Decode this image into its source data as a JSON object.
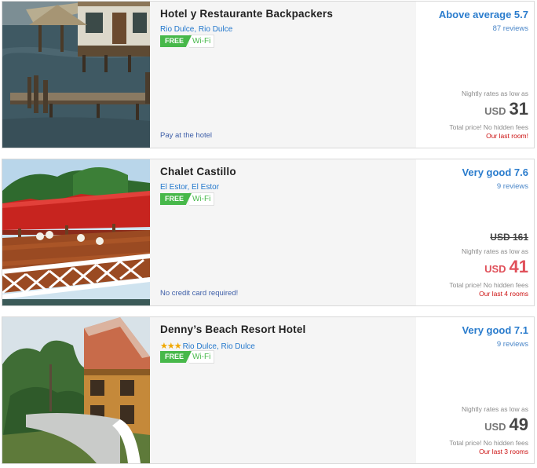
{
  "hotels": [
    {
      "name": "Hotel y Restaurante Backpackers",
      "stars": "",
      "location": "Rio Dulce, Rio Dulce",
      "free_badge": "FREE",
      "amenity": "Wi-Fi",
      "footnote": "Pay at the hotel",
      "rating": "Above average 5.7",
      "reviews": "87 reviews",
      "old_price": "",
      "rates_note": "Nightly rates as low as",
      "currency": "USD",
      "price": "31",
      "total_note": "Total price! No hidden fees",
      "availability": "Our last room!",
      "photo": "stilt-house-dock"
    },
    {
      "name": "Chalet Castillo",
      "stars": "",
      "location": "El Estor, El Estor",
      "free_badge": "FREE",
      "amenity": "Wi-Fi",
      "footnote": "No credit card required!",
      "rating": "Very good 7.6",
      "reviews": "9 reviews",
      "old_price": "USD 161",
      "rates_note": "Nightly rates as low as",
      "currency": "USD",
      "price": "41",
      "total_note": "Total price! No hidden fees",
      "availability": "Our last 4 rooms",
      "photo": "red-roof-deck"
    },
    {
      "name": "Denny’s Beach Resort Hotel",
      "stars": "★★★",
      "location": "Rio Dulce, Rio Dulce",
      "free_badge": "FREE",
      "amenity": "Wi-Fi",
      "footnote": "",
      "rating": "Very good 7.1",
      "reviews": "9 reviews",
      "old_price": "",
      "rates_note": "Nightly rates as low as",
      "currency": "USD",
      "price": "49",
      "total_note": "Total price! No hidden fees",
      "availability": "Our last 3 rooms",
      "photo": "wooden-lodge-shore"
    }
  ],
  "colors": {
    "link_blue": "#2277cc",
    "rating_blue": "#2a7ccd",
    "free_green": "#47b84a",
    "deal_red": "#e0505a",
    "alert_red": "#cc1111"
  }
}
